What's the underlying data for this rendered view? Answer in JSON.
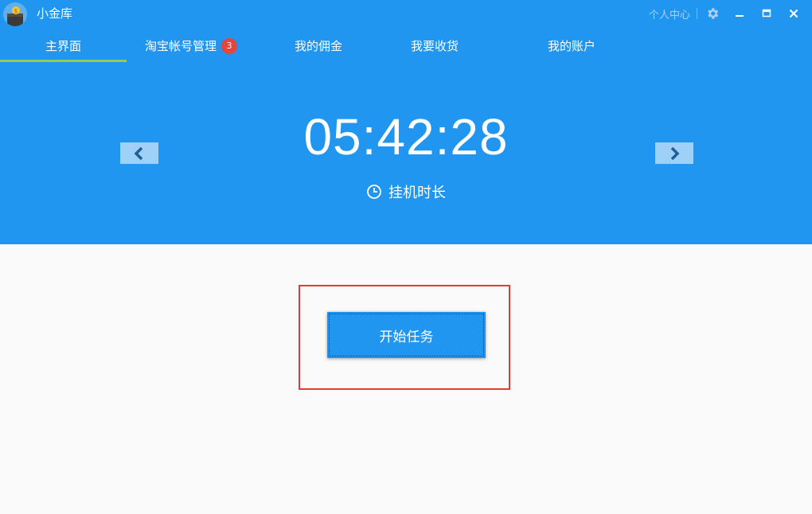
{
  "app": {
    "title": "小金库"
  },
  "window": {
    "profile_link": "个人中心"
  },
  "tabs": [
    {
      "label": "主界面",
      "active": true
    },
    {
      "label": "淘宝帐号管理",
      "badge": "3"
    },
    {
      "label": "我的佣金"
    },
    {
      "label": "我要收货"
    },
    {
      "label": "我的账户"
    }
  ],
  "timer": {
    "value": "05:42:28",
    "label": "挂机时长"
  },
  "actions": {
    "start_label": "开始任务"
  },
  "colors": {
    "brand": "#2196f0",
    "tab_underline": "#8fd14f",
    "badge": "#e2463f",
    "highlight": "#e53935"
  },
  "icons": [
    "app-avatar-icon",
    "gear-icon",
    "minimize-icon",
    "maximize-icon",
    "close-icon",
    "chevron-left-icon",
    "chevron-right-icon",
    "clock-icon"
  ]
}
